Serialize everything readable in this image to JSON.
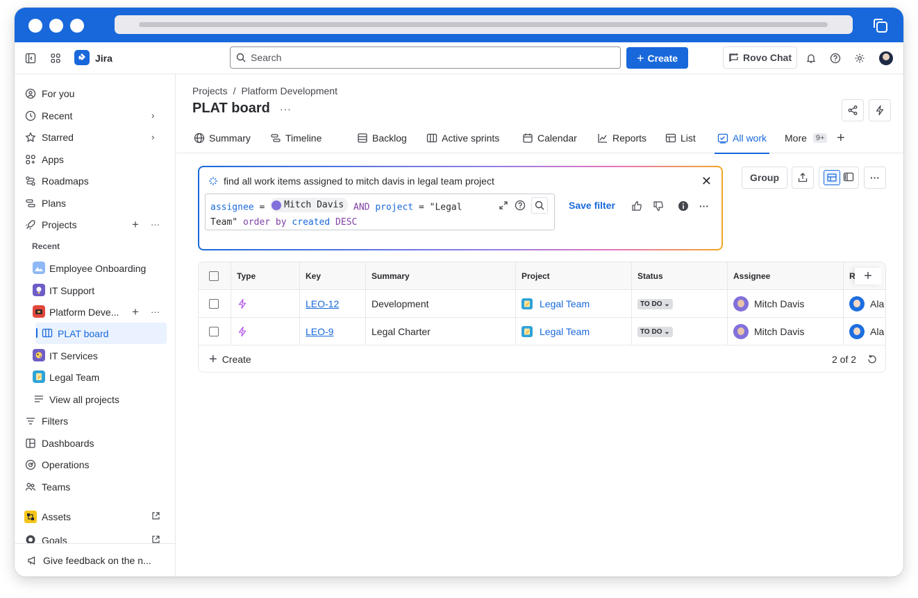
{
  "topnav": {
    "app_name": "Jira",
    "search_placeholder": "Search",
    "create_label": "Create",
    "rovo_label": "Rovo Chat"
  },
  "sidebar": {
    "items": [
      {
        "label": "For you"
      },
      {
        "label": "Recent"
      },
      {
        "label": "Starred"
      },
      {
        "label": "Apps"
      },
      {
        "label": "Roadmaps"
      },
      {
        "label": "Plans"
      },
      {
        "label": "Projects"
      }
    ],
    "recent_heading": "Recent",
    "recent_projects": [
      {
        "label": "Employee Onboarding"
      },
      {
        "label": "IT Support"
      },
      {
        "label": "Platform Deve..."
      },
      {
        "label": "PLAT board"
      },
      {
        "label": "IT Services"
      },
      {
        "label": "Legal Team"
      },
      {
        "label": "View all projects"
      }
    ],
    "lower_items": [
      {
        "label": "Filters"
      },
      {
        "label": "Dashboards"
      },
      {
        "label": "Operations"
      },
      {
        "label": "Teams"
      },
      {
        "label": "Assets"
      },
      {
        "label": "Goals"
      }
    ],
    "feedback_label": "Give feedback on the n..."
  },
  "page": {
    "breadcrumb_root": "Projects",
    "breadcrumb_sep": "/",
    "breadcrumb_project": "Platform Development",
    "title": "PLAT board",
    "more": "···"
  },
  "tabs": [
    {
      "label": "Summary"
    },
    {
      "label": "Timeline"
    },
    {
      "label": "Backlog"
    },
    {
      "label": "Active sprints"
    },
    {
      "label": "Calendar"
    },
    {
      "label": "Reports"
    },
    {
      "label": "List"
    },
    {
      "label": "All work"
    },
    {
      "label": "More"
    }
  ],
  "more_badge": "9+",
  "jql": {
    "prompt": "find all work items assigned to mitch davis in legal team project",
    "tokens": {
      "field1": "assignee",
      "eq": "=",
      "user": "Mitch Davis",
      "and": "AND",
      "field2": "project",
      "eq2": "=",
      "value1": "\"Legal",
      "value2": "Team\"",
      "order": "order by",
      "field3": "created",
      "dir": "DESC"
    },
    "save_filter": "Save filter"
  },
  "toolbar": {
    "group_label": "Group"
  },
  "table": {
    "headers": [
      "Type",
      "Key",
      "Summary",
      "Project",
      "Status",
      "Assignee",
      "R"
    ],
    "rows": [
      {
        "key": "LEO-12",
        "summary": "Development",
        "project": "Legal Team",
        "status": "TO DO",
        "assignee": "Mitch Davis",
        "reporter": "Ala"
      },
      {
        "key": "LEO-9",
        "summary": "Legal Charter",
        "project": "Legal Team",
        "status": "TO DO",
        "assignee": "Mitch Davis",
        "reporter": "Ala"
      }
    ],
    "create_label": "Create",
    "count": "2 of 2"
  },
  "colors": {
    "brand": "#1868db",
    "text": "#292a2e",
    "jql_keyword": "#803fa5"
  }
}
